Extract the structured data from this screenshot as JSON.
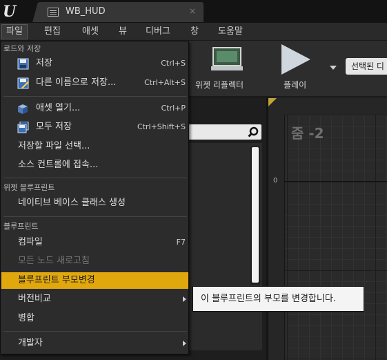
{
  "title_bar": {
    "tab_title": "WB_HUD",
    "close_glyph": "×"
  },
  "menubar": {
    "items": [
      "파일",
      "편집",
      "애셋",
      "뷰",
      "디버그",
      "창",
      "도움말"
    ],
    "active_index": 0
  },
  "toolbar": {
    "reflector_label": "위젯 리플렉터",
    "play_label": "플레이",
    "debug_select_value": "선택된 디"
  },
  "graph": {
    "zoom_label": "줌 -2",
    "ruler_zero": "0"
  },
  "file_menu": {
    "section_load_save": "로드와 저장",
    "save": {
      "label": "저장",
      "shortcut": "Ctrl+S",
      "icon": "save-icon"
    },
    "save_as": {
      "label": "다른 이름으로 저장...",
      "shortcut": "Ctrl+Alt+S",
      "icon": "save-as-icon"
    },
    "open_asset": {
      "label": "애셋 열기...",
      "shortcut": "Ctrl+P",
      "icon": "open-asset-icon"
    },
    "save_all": {
      "label": "모두 저장",
      "shortcut": "Ctrl+Shift+S",
      "icon": "save-all-icon"
    },
    "choose_files": {
      "label": "저장할 파일 선택..."
    },
    "source_control": {
      "label": "소스 컨트롤에 접속..."
    },
    "section_widget_blueprint": "위젯 블루프린트",
    "native_base": {
      "label": "네이티브 베이스 클래스 생성"
    },
    "section_blueprint": "블루프린트",
    "compile": {
      "label": "컴파일",
      "shortcut": "F7"
    },
    "refresh_nodes": {
      "label": "모든 노드 새로고침"
    },
    "reparent": {
      "label": "블루프린트 부모변경"
    },
    "diff": {
      "label": "버전비교"
    },
    "merge": {
      "label": "병합"
    },
    "developer": {
      "label": "개발자"
    }
  },
  "tooltip": {
    "text": "이 블루프린트의 부모를 변경합니다."
  },
  "colors": {
    "highlight": "#e1a80e",
    "menu_bg": "#2c2c2c",
    "disabled_text": "#747474"
  }
}
